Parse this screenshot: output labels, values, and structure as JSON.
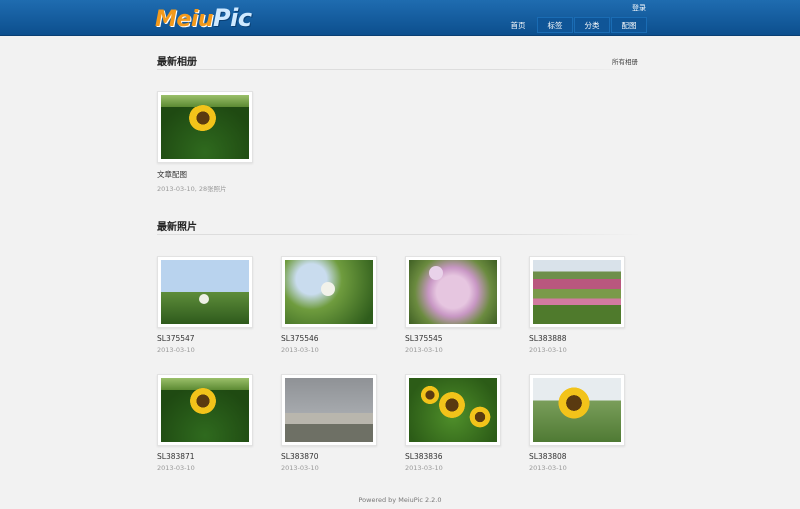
{
  "header": {
    "logo_part1": "Meiu",
    "logo_part2": "Pic",
    "login": "登录",
    "nav": [
      "首页",
      "标签",
      "分类",
      "配图"
    ]
  },
  "albums_section": {
    "title": "最新相册",
    "all_link": "所有相册",
    "items": [
      {
        "title": "文章配图",
        "meta": "2013-03-10, 28张照片"
      }
    ]
  },
  "photos_section": {
    "title": "最新照片",
    "items": [
      {
        "title": "SL375547",
        "date": "2013-03-10"
      },
      {
        "title": "SL375546",
        "date": "2013-03-10"
      },
      {
        "title": "SL375545",
        "date": "2013-03-10"
      },
      {
        "title": "SL383888",
        "date": "2013-03-10"
      },
      {
        "title": "SL383871",
        "date": "2013-03-10"
      },
      {
        "title": "SL383870",
        "date": "2013-03-10"
      },
      {
        "title": "SL383836",
        "date": "2013-03-10"
      },
      {
        "title": "SL383808",
        "date": "2013-03-10"
      }
    ]
  },
  "footer": {
    "text": "Powered by MeiuPic 2.2.0"
  }
}
